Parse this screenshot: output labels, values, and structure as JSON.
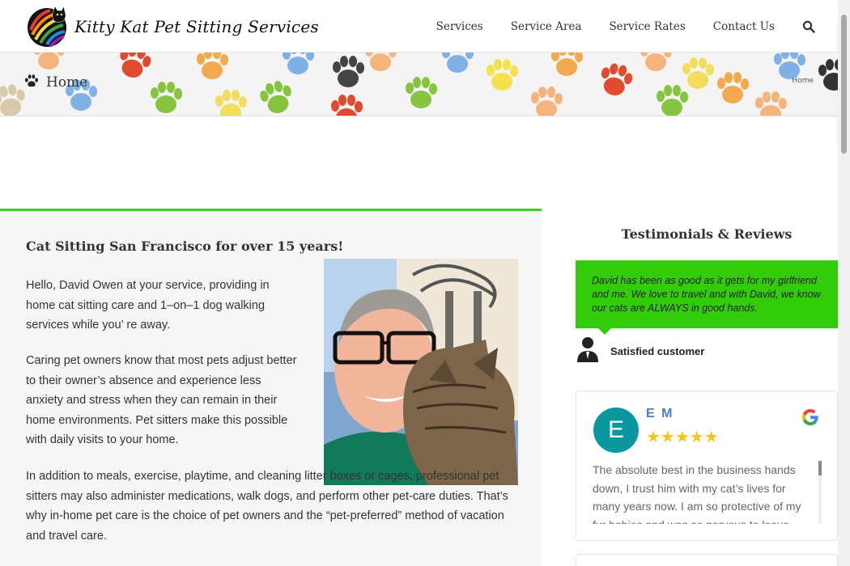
{
  "site": {
    "brand": "Kitty Kat Pet Sitting Services"
  },
  "nav": {
    "items": [
      "Services",
      "Service Area",
      "Service Rates",
      "Contact Us"
    ]
  },
  "banner": {
    "title": "Home",
    "breadcrumb": "Home"
  },
  "main": {
    "heading": "Cat Sitting San Francisco for over 15 years!",
    "paragraphs": [
      "Hello, David Owen at your service, providing in home cat sitting care and 1–on–1 dog walking services while you’ re away.",
      "Caring pet owners know that most pets adjust better to their owner’s absence and experience less anxiety and stress when they can remain in their home environments. Pet sitters make this possible with daily visits to your home.",
      "In addition to meals, exercise, playtime, and cleaning litter boxes or cages, professional pet sitters may also administer medications, walk dogs, and perform other pet-care duties. That’s why in-home pet care is the choice of pet owners and the “pet-preferred” method of vacation and travel care."
    ]
  },
  "sidebar": {
    "heading": "Testimonials & Reviews",
    "testimonial": {
      "quote": "David has been as good as it gets for my girlfriend and me. We love to travel and with David, we know our cats are ALWAYS in good hands.",
      "author": "Satisfied customer"
    },
    "review": {
      "initial": "E",
      "name": "E M",
      "rating": 5,
      "stars": "★★★★★",
      "text": "The absolute best in the business hands down, I trust him with my cat’s lives for many years now. I am so protective of my fur babies and was so nervous to leave"
    }
  },
  "colors": {
    "accent_green": "#44c930",
    "testimonial_green": "#33cc0a",
    "avatar_teal": "#0a97a0",
    "reviewer_blue": "#4a7ec9",
    "star_gold": "#f5c518"
  },
  "icons": [
    "cat-logo-icon",
    "search-icon",
    "paw-icon",
    "user-silhouette-icon",
    "google-icon"
  ]
}
